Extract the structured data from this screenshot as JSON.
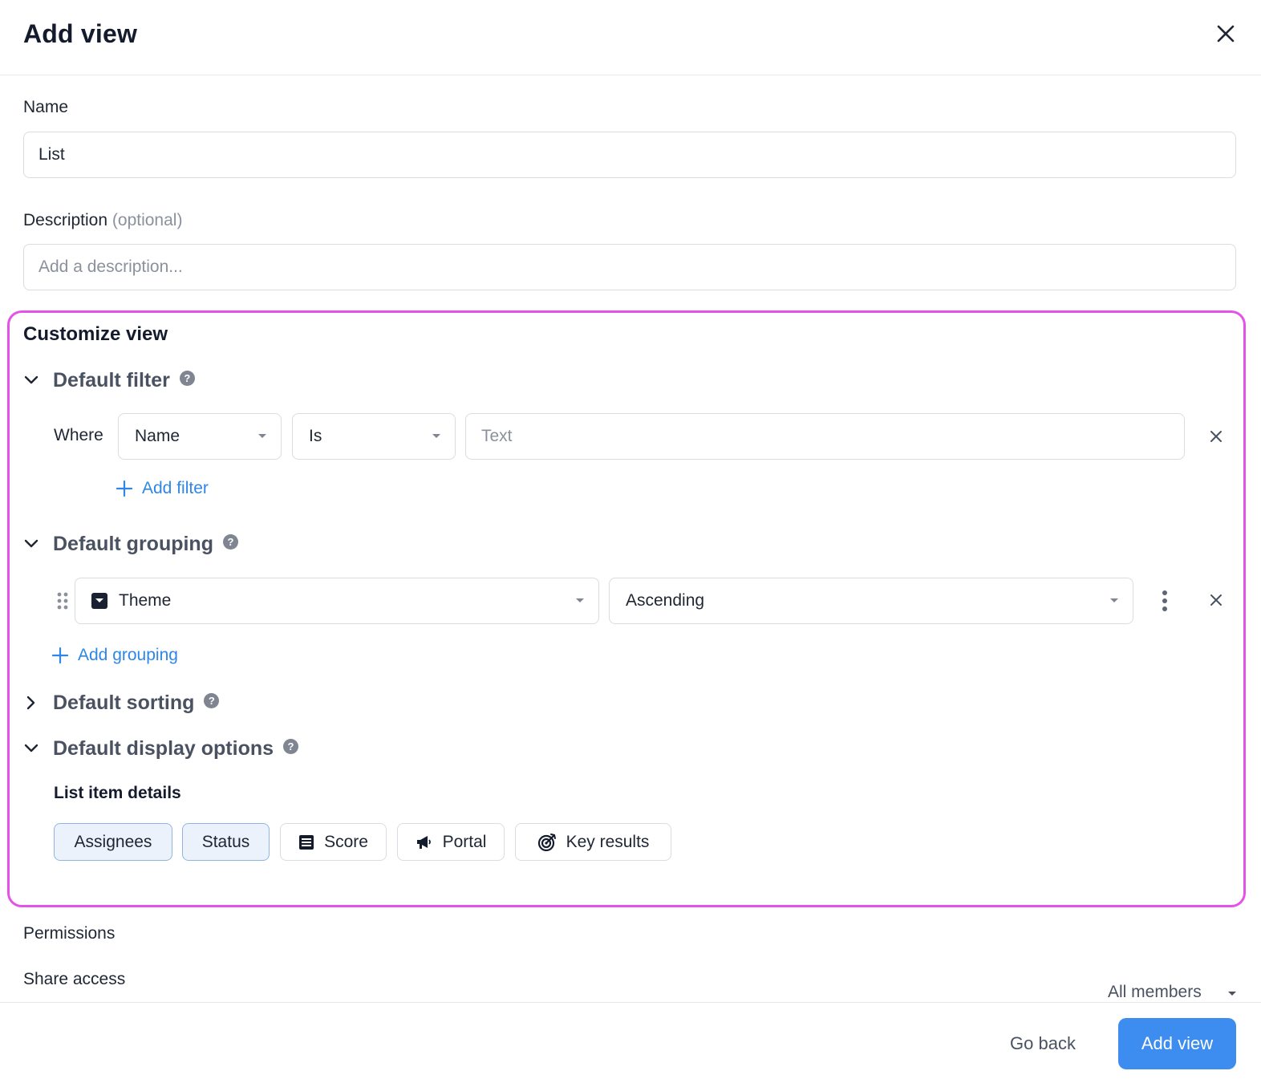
{
  "header": {
    "title": "Add view"
  },
  "name_field": {
    "label": "Name",
    "value": "List"
  },
  "description_field": {
    "label": "Description",
    "optional": "(optional)",
    "placeholder": "Add a description..."
  },
  "customize": {
    "title": "Customize view",
    "filter": {
      "title": "Default filter",
      "expanded": true,
      "where_label": "Where",
      "field_select": "Name",
      "operator_select": "Is",
      "value_placeholder": "Text",
      "add_label": "Add filter"
    },
    "grouping": {
      "title": "Default grouping",
      "expanded": true,
      "field_select": "Theme",
      "order_select": "Ascending",
      "add_label": "Add grouping"
    },
    "sorting": {
      "title": "Default sorting",
      "expanded": false
    },
    "display": {
      "title": "Default display options",
      "expanded": true,
      "list_item_details": "List item details",
      "chips": [
        {
          "label": "Assignees",
          "selected": true
        },
        {
          "label": "Status",
          "selected": true
        },
        {
          "label": "Score",
          "selected": false,
          "icon": "score-icon"
        },
        {
          "label": "Portal",
          "selected": false,
          "icon": "megaphone-icon"
        },
        {
          "label": "Key results",
          "selected": false,
          "icon": "target-icon"
        }
      ]
    }
  },
  "permissions": {
    "title": "Permissions",
    "share_access": "Share access",
    "share_value": "All members"
  },
  "footer": {
    "back_label": "Go back",
    "submit_label": "Add view"
  },
  "colors": {
    "accent": "#3d8cf0",
    "link": "#2f86e8",
    "highlight_border": "#e452e8",
    "chip_selected_bg": "#ebf2fb"
  }
}
